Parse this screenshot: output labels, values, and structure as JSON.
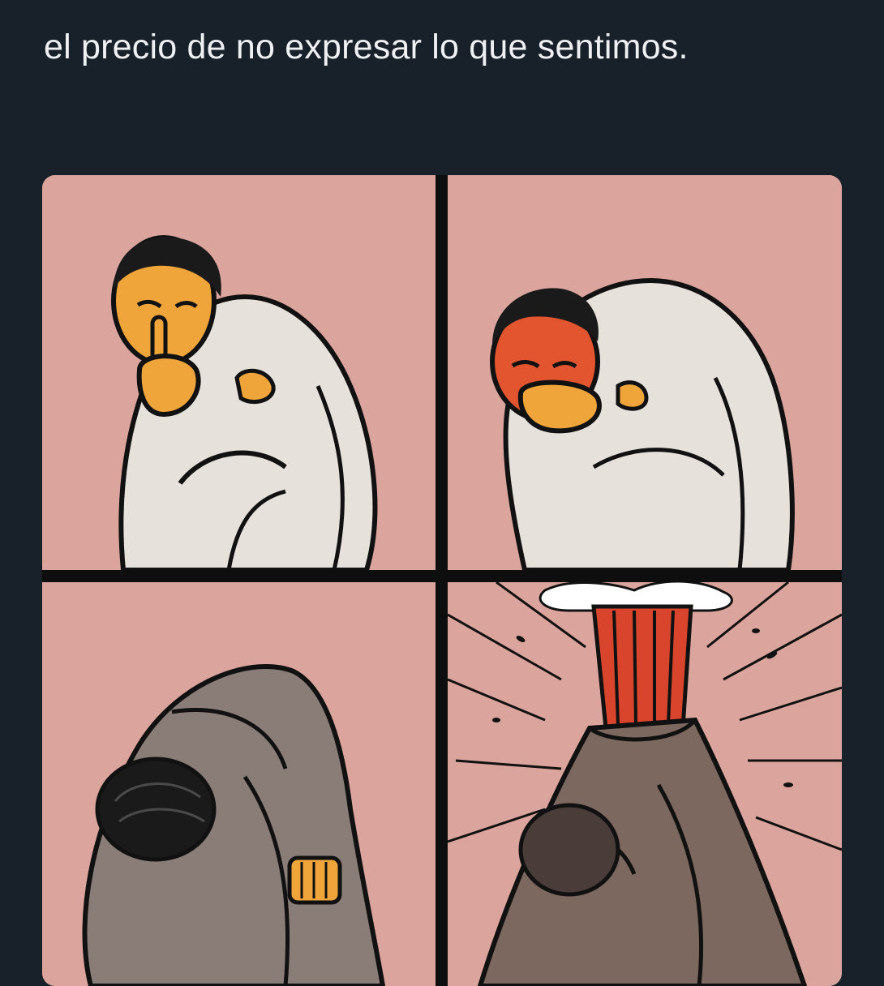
{
  "tweet": {
    "text": "el precio de no expresar lo que sentimos."
  },
  "media": {
    "panels": [
      {
        "scene": "shushing",
        "face_color": "#f0a53b"
      },
      {
        "scene": "covering-mouth",
        "face_color": "#e2552e"
      },
      {
        "scene": "curled-up",
        "face_color": "#6a5a52"
      },
      {
        "scene": "volcano-eruption",
        "lava_color": "#d9452c"
      }
    ],
    "palette": {
      "background": "#18202a",
      "panel_pink": "#dba59d",
      "shirt": "#e7e1dc",
      "rock": "#7d6860",
      "lava": "#d9452c"
    }
  }
}
